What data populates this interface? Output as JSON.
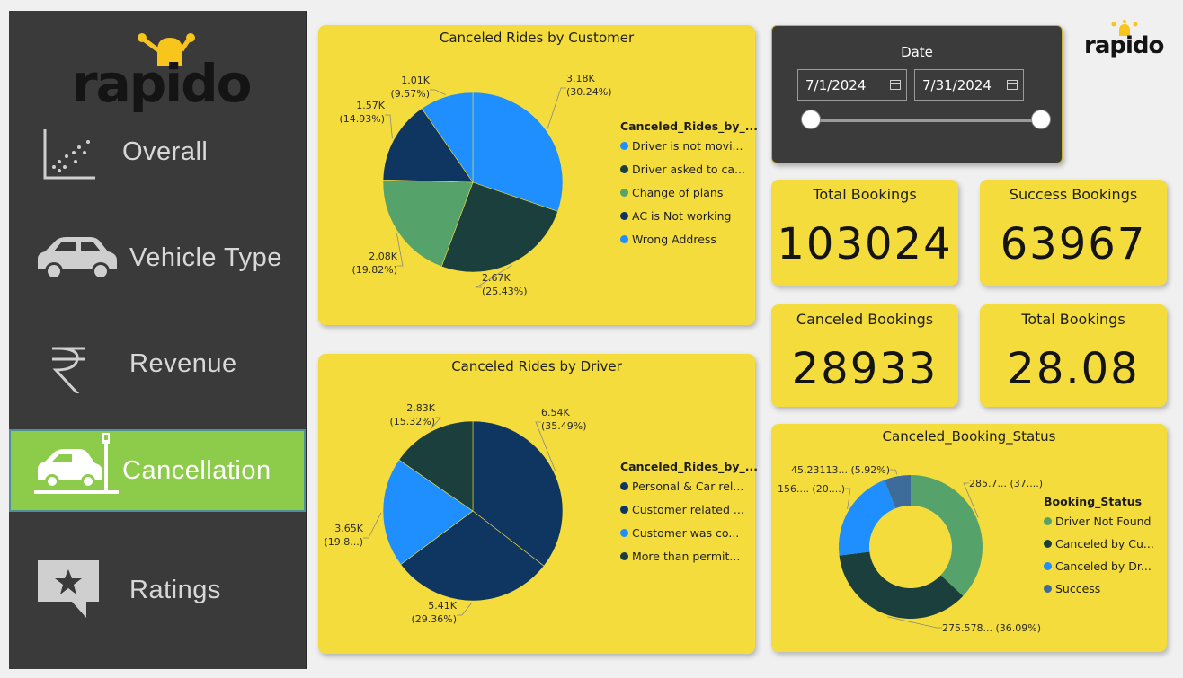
{
  "sidebar": {
    "logo_text": "rapido",
    "items": [
      {
        "label": "Overall"
      },
      {
        "label": "Vehicle Type"
      },
      {
        "label": "Revenue"
      },
      {
        "label": "Cancellation"
      },
      {
        "label": "Ratings"
      }
    ]
  },
  "header": {
    "brand_text": "rapido"
  },
  "date_slicer": {
    "title": "Date",
    "start": "7/1/2024",
    "end": "7/31/2024",
    "range_fraction": [
      0,
      1
    ]
  },
  "kpis": [
    {
      "title": "Total Bookings",
      "value": "103024"
    },
    {
      "title": "Success Bookings",
      "value": "63967"
    },
    {
      "title": "Canceled Bookings",
      "value": "28933"
    },
    {
      "title": "Total Bookings",
      "value": "28.08"
    }
  ],
  "colors": {
    "panel_bg": "#f4dc3c",
    "sidebar_bg": "#3a3a3a",
    "active_nav": "#8dcc4a",
    "blue": "#1f8fff",
    "dark_green": "#1b3f3c",
    "green": "#55a26a",
    "navy": "#0f3561",
    "steel": "#3d6b9a"
  },
  "chart_data": [
    {
      "type": "pie",
      "title": "Canceled Rides by Customer",
      "legend_title": "Canceled_Rides_by_...",
      "legend": [
        "Driver is not movi...",
        "Driver asked to ca...",
        "Change of plans",
        "AC is Not working",
        "Wrong Address"
      ],
      "labels": [
        "3.18K (30.24%)",
        "2.67K (25.43%)",
        "2.08K (19.82%)",
        "1.57K (14.93%)",
        "1.01K (9.57%)"
      ],
      "values": [
        3180,
        2670,
        2080,
        1570,
        1010
      ],
      "colors": [
        "#1f8fff",
        "#1b3f3c",
        "#55a26a",
        "#0f3561",
        "#1f8fff"
      ]
    },
    {
      "type": "pie",
      "title": "Canceled Rides by Driver",
      "legend_title": "Canceled_Rides_by_...",
      "legend": [
        "Personal & Car rel...",
        "Customer related ...",
        "Customer was co...",
        "More than permit..."
      ],
      "labels": [
        "6.54K (35.49%)",
        "5.41K (29.36%)",
        "3.65K (19.8...)",
        "2.83K (15.32%)"
      ],
      "values": [
        6540,
        5410,
        3650,
        2830
      ],
      "colors": [
        "#0f3561",
        "#0f3561",
        "#1f8fff",
        "#1b3f3c"
      ]
    },
    {
      "type": "donut",
      "title": "Canceled_Booking_Status",
      "legend_title": "Booking_Status",
      "legend": [
        "Driver Not Found",
        "Canceled by Cu...",
        "Canceled by Dr...",
        "Success"
      ],
      "labels": [
        "285.7... (37....)",
        "275.578... (36.09%)",
        "156.... (20....)",
        "45.23113... (5.92%)"
      ],
      "values": [
        37.0,
        36.09,
        20.99,
        5.92
      ],
      "colors": [
        "#55a26a",
        "#1b3f3c",
        "#1f8fff",
        "#3d6b9a"
      ]
    }
  ]
}
